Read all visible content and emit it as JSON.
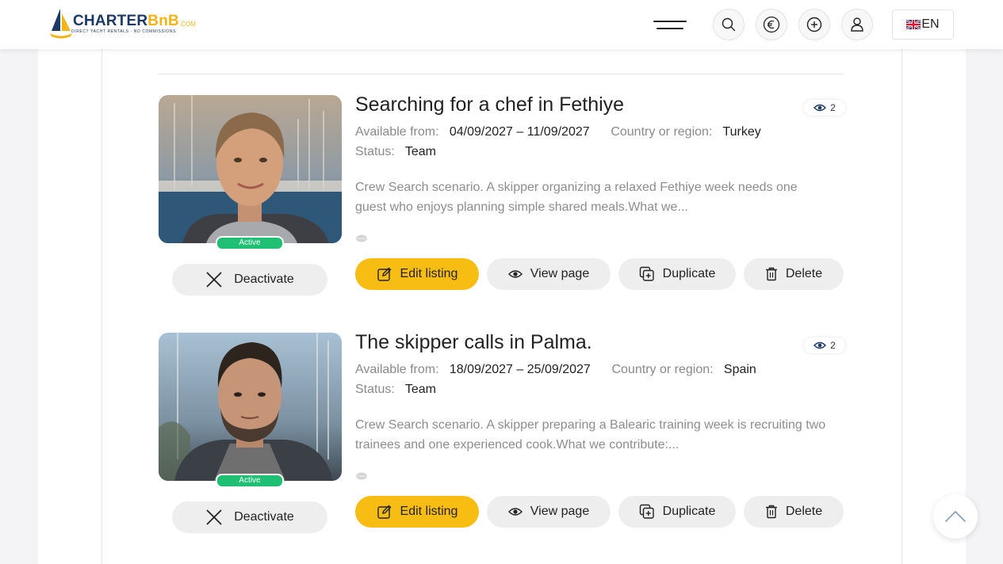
{
  "header": {
    "logo_main_1": "CHARTER",
    "logo_main_2": "BnB",
    "logo_suffix": ".COM",
    "logo_tagline": "DIRECT YACHT RENTALS · NO COMMISSIONS",
    "lang_label": "EN",
    "icons": [
      "menu-icon",
      "search-icon",
      "euro-icon",
      "plus-circle-icon",
      "user-icon",
      "uk-flag-icon"
    ]
  },
  "labels": {
    "available_from": "Available from:",
    "country": "Country or region:",
    "status": "Status:",
    "badge": "Active",
    "deactivate": "Deactivate",
    "edit": "Edit listing",
    "view": "View page",
    "duplicate": "Duplicate",
    "delete": "Delete"
  },
  "listings": [
    {
      "title": "Searching for a chef in Fethiye",
      "views": "2",
      "dates": "04/09/2027 – 11/09/2027",
      "country": "Turkey",
      "status": "Team",
      "description": "Crew Search scenario. A skipper organizing a relaxed Fethiye week needs one guest who enjoys planning simple shared meals.What we..."
    },
    {
      "title": "The skipper calls in Palma.",
      "views": "2",
      "dates": "18/09/2027 – 25/09/2027",
      "country": "Spain",
      "status": "Team",
      "description": "Crew Search scenario. A skipper preparing a Balearic training week is recruiting two trainees and one experienced cook.What we contribute:..."
    }
  ],
  "colors": {
    "accent": "#f8bd12",
    "active_badge": "#1fbf74",
    "brand_navy": "#1c3a63",
    "brand_gold": "#f2b418"
  }
}
